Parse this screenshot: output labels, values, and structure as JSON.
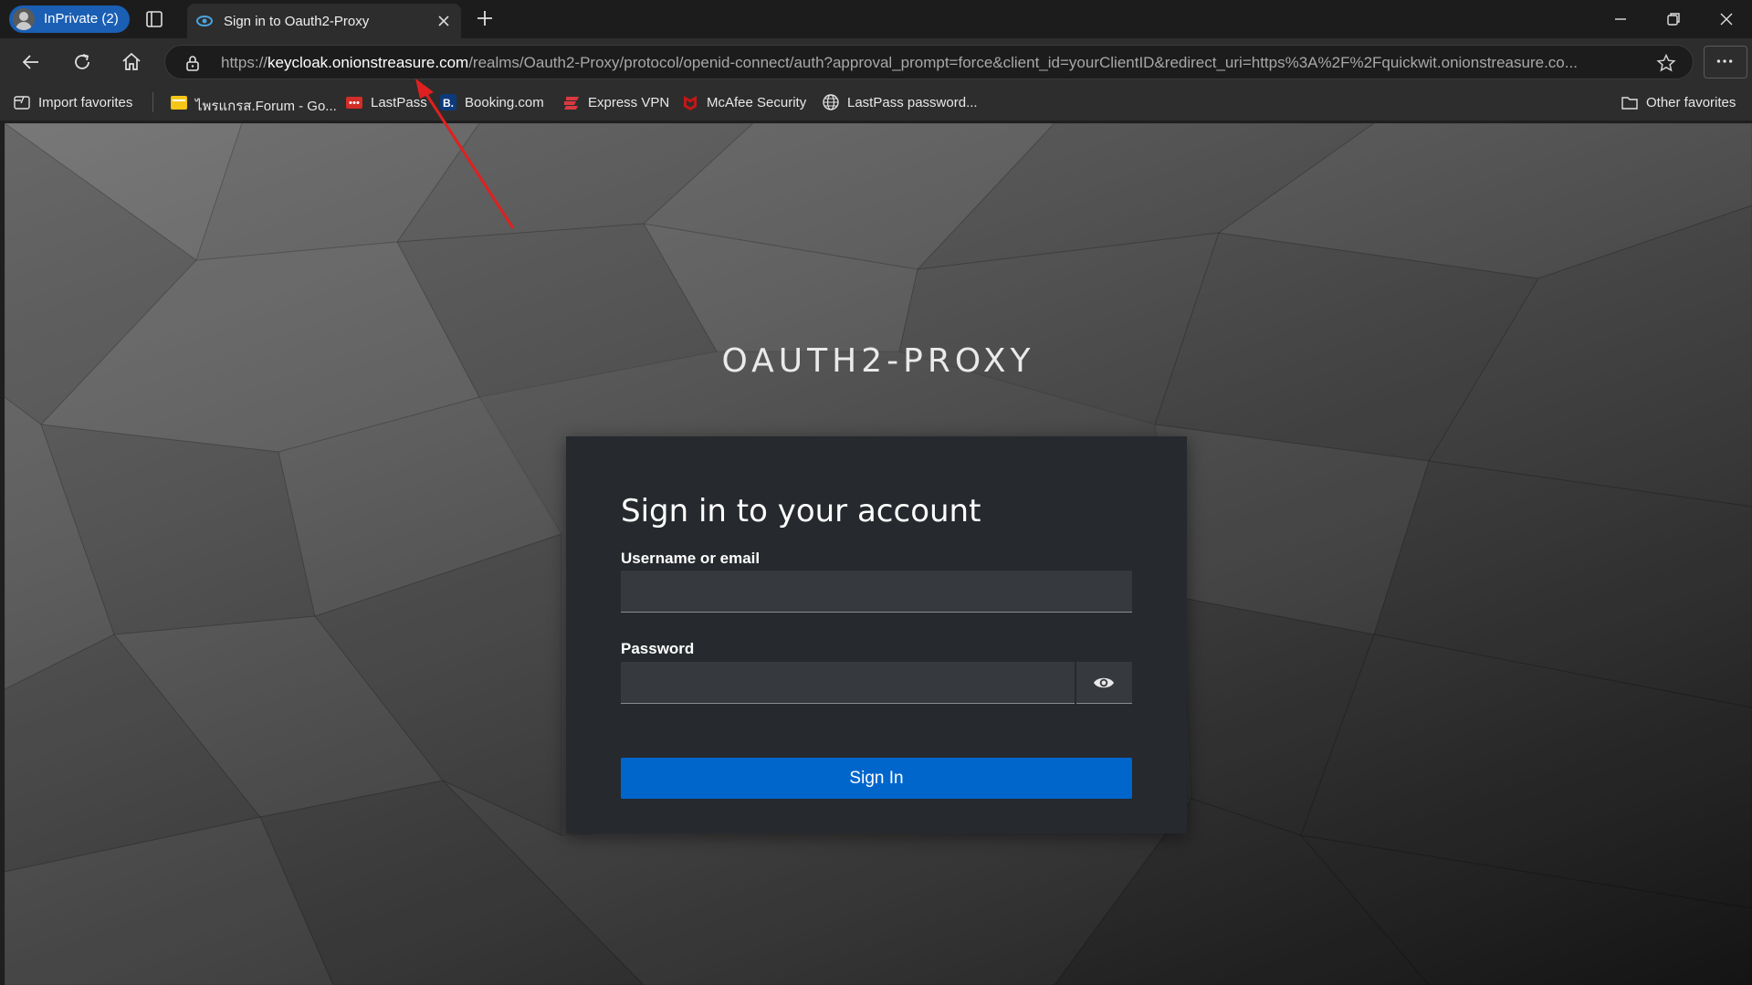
{
  "browser": {
    "profile_label": "InPrivate (2)",
    "tab_title": "Sign in to Oauth2-Proxy",
    "url_scheme": "https://",
    "url_host": "keycloak.onionstreasure.com",
    "url_rest": "/realms/Oauth2-Proxy/protocol/openid-connect/auth?approval_prompt=force&client_id=yourClientID&redirect_uri=https%3A%2F%2Fquickwit.onionstreasure.co...",
    "favorites": [
      {
        "label": "Import favorites",
        "icon": "import-icon"
      },
      {
        "label": "ไพรแกรส.Forum - Go...",
        "icon": "folder-icon"
      },
      {
        "label": "LastPass",
        "icon": "lastpass-icon"
      },
      {
        "label": "Booking.com",
        "icon": "booking-icon"
      },
      {
        "label": "Express VPN",
        "icon": "expressvpn-icon"
      },
      {
        "label": "McAfee Security",
        "icon": "mcafee-icon"
      },
      {
        "label": "LastPass password...",
        "icon": "globe-icon"
      }
    ],
    "other_favorites": "Other favorites"
  },
  "login": {
    "brand": "OAUTH2-PROXY",
    "heading": "Sign in to your account",
    "username_label": "Username or email",
    "username_value": "",
    "password_label": "Password",
    "password_value": "",
    "submit_label": "Sign In"
  },
  "colors": {
    "accent": "#0066cc",
    "inprivate_badge": "#1a5fb4",
    "annotation_arrow": "#e02020"
  }
}
